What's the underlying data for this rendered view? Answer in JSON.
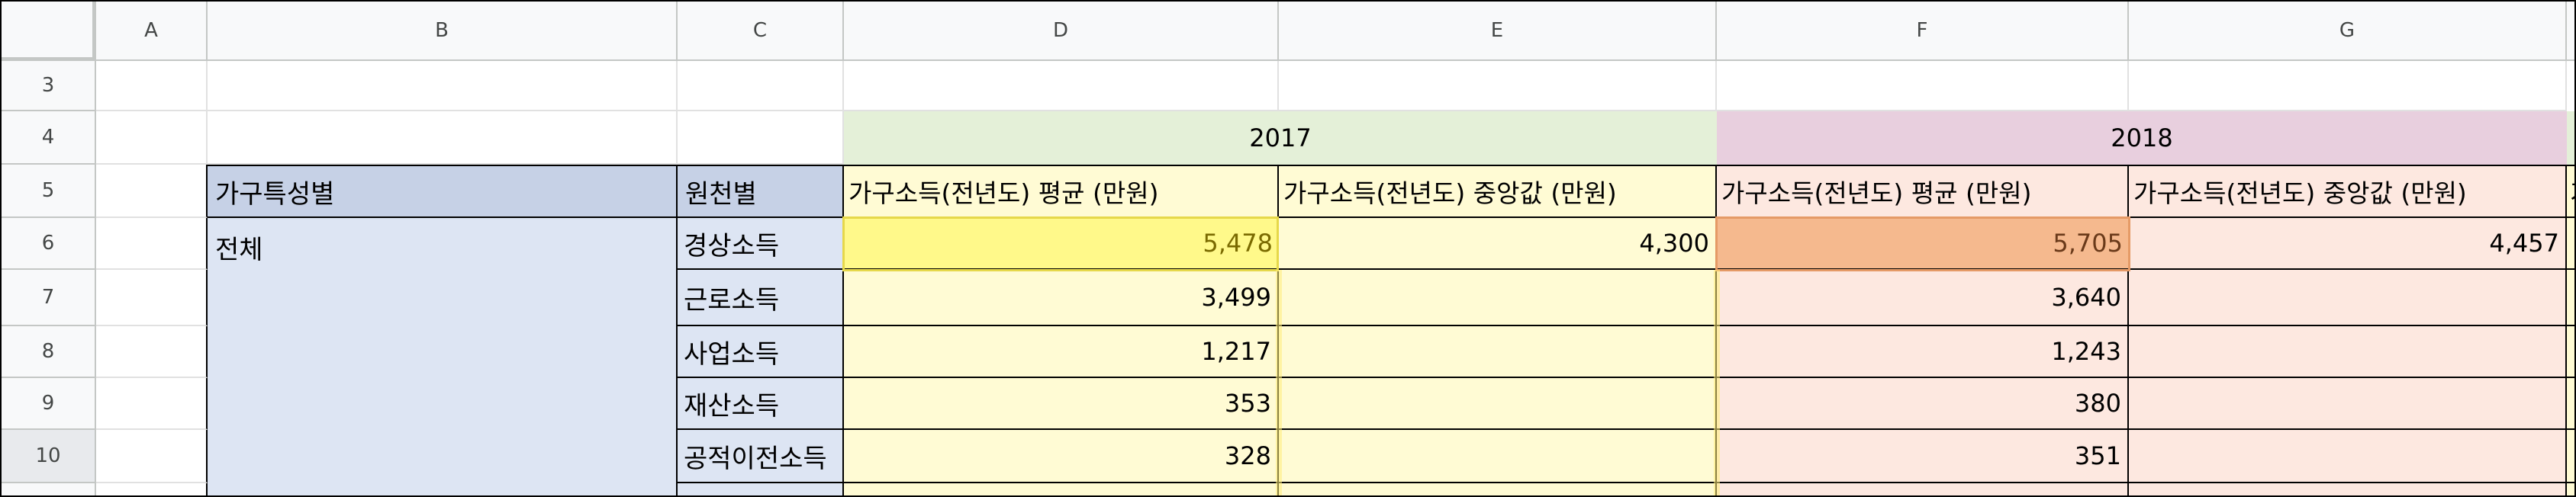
{
  "sheet": {
    "column_headers": [
      "A",
      "B",
      "C",
      "D",
      "E",
      "F",
      "G"
    ],
    "row_headers": [
      "3",
      "4",
      "5",
      "6",
      "7",
      "8",
      "9",
      "10"
    ],
    "year_2017": "2017",
    "year_2018": "2018",
    "header_row": {
      "b": "가구특성별",
      "c": "원천별",
      "d": "가구소득(전년도) 평균 (만원)",
      "e": "가구소득(전년도) 중앙값 (만원)",
      "f": "가구소득(전년도) 평균 (만원)",
      "g": "가구소득(전년도) 중앙값 (만원)",
      "h_partial": "가"
    },
    "b_total": "전체",
    "rows": [
      {
        "c": "경상소득",
        "d": "5,478",
        "e": "4,300",
        "f": "5,705",
        "g": "4,457"
      },
      {
        "c": "근로소득",
        "d": "3,499",
        "e": "",
        "f": "3,640",
        "g": ""
      },
      {
        "c": "사업소득",
        "d": "1,217",
        "e": "",
        "f": "1,243",
        "g": ""
      },
      {
        "c": "재산소득",
        "d": "353",
        "e": "",
        "f": "380",
        "g": ""
      },
      {
        "c": "공적이전소득",
        "d": "328",
        "e": "",
        "f": "351",
        "g": ""
      }
    ],
    "colors": {
      "year_2017_bg": "#e4f0d8",
      "year_2018_bg": "#e8cfde",
      "header_bg": "#c6d1e6",
      "b_col_bg": "#dde5f3",
      "y2017_data_bg": "#fffbd4",
      "y2018_data_bg": "#fde8e0",
      "selected_2017": "#fff98a",
      "selected_2018": "#f5b98e"
    }
  }
}
